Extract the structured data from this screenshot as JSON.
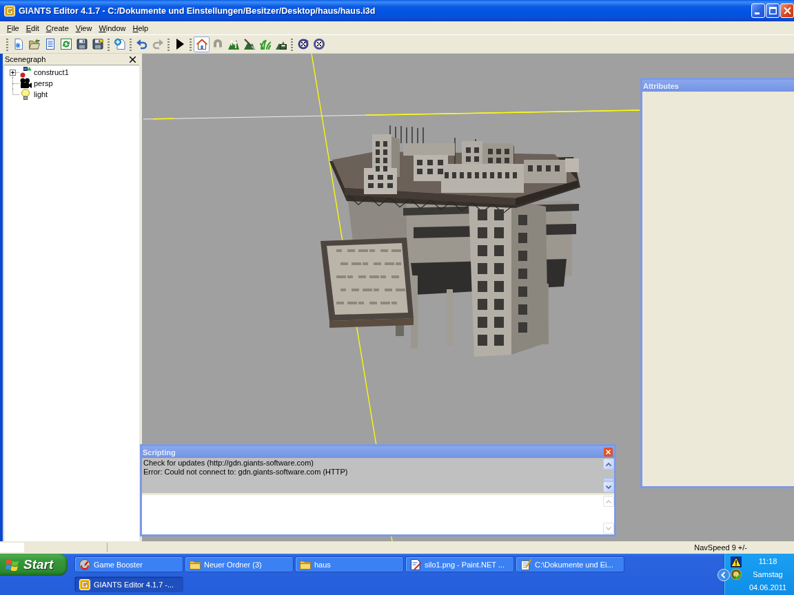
{
  "window": {
    "title": "GIANTS Editor 4.1.7 - C:/Dokumente und Einstellungen/Besitzer/Desktop/haus/haus.i3d"
  },
  "menu": [
    "File",
    "Edit",
    "Create",
    "View",
    "Window",
    "Help"
  ],
  "toolbar": {
    "groups": [
      {
        "buttons": [
          {
            "pressed": false,
            "disabled": false
          },
          {
            "pressed": false,
            "disabled": false
          },
          {
            "pressed": false,
            "disabled": false
          },
          {
            "pressed": false,
            "disabled": false
          },
          {
            "pressed": false,
            "disabled": false
          },
          {
            "pressed": false,
            "disabled": false
          }
        ]
      },
      {
        "buttons": [
          {
            "pressed": false,
            "disabled": false
          }
        ]
      },
      {
        "buttons": [
          {
            "pressed": false,
            "disabled": false
          },
          {
            "pressed": false,
            "disabled": true
          }
        ]
      },
      {
        "buttons": [
          {
            "pressed": false,
            "disabled": false
          }
        ]
      },
      {
        "buttons": [
          {
            "pressed": true,
            "disabled": false
          },
          {
            "pressed": false,
            "disabled": true
          },
          {
            "pressed": false,
            "disabled": false
          },
          {
            "pressed": false,
            "disabled": false
          },
          {
            "pressed": false,
            "disabled": false
          },
          {
            "pressed": false,
            "disabled": false
          }
        ]
      },
      {
        "buttons": [
          {
            "pressed": false,
            "disabled": false
          },
          {
            "pressed": false,
            "disabled": false
          }
        ]
      }
    ]
  },
  "scenegraph": {
    "title": "Scenegraph",
    "tree": [
      {
        "label": "construct1",
        "kind": "transform",
        "has_children": true,
        "expanded": false
      },
      {
        "label": "persp",
        "kind": "camera",
        "has_children": false
      },
      {
        "label": "light",
        "kind": "light",
        "has_children": false
      }
    ]
  },
  "attributes": {
    "title": "Attributes"
  },
  "scripting": {
    "title": "Scripting",
    "output": [
      "Check for updates (http://gdn.giants-software.com)",
      "Error: Could not connect to: gdn.giants-software.com (HTTP)"
    ]
  },
  "status_bar": {
    "nav_speed": "NavSpeed 9 +/-"
  },
  "taskbar": {
    "start": "Start",
    "buttons": [
      {
        "label": "Game Booster",
        "kind": "gauge",
        "selected": false
      },
      {
        "label": "Neuer Ordner (3)",
        "kind": "folder",
        "selected": false
      },
      {
        "label": "haus",
        "kind": "folder",
        "selected": false
      },
      {
        "label": "silo1.png - Paint.NET ...",
        "kind": "paint",
        "selected": false
      },
      {
        "label": "C:\\Dokumente und Ei...",
        "kind": "notepad",
        "selected": false
      },
      {
        "label": "GIANTS Editor 4.1.7 -...",
        "kind": "logo",
        "selected": true
      }
    ],
    "clock": {
      "time": "11:18",
      "day": "Samstag",
      "date": "04.06.2011"
    }
  }
}
